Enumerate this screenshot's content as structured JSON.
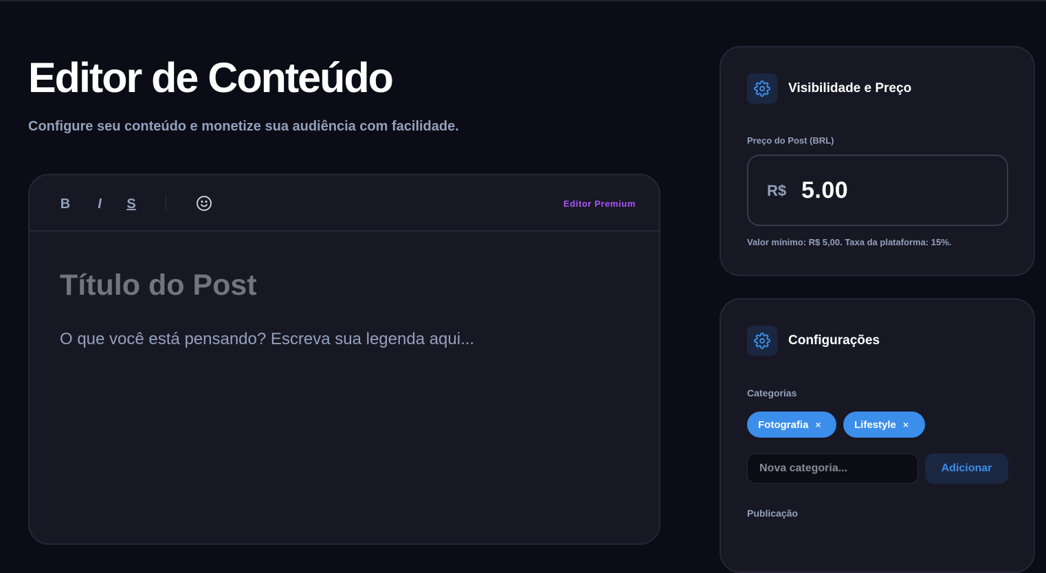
{
  "header": {
    "title": "Editor de Conteúdo",
    "subtitle": "Configure seu conteúdo e monetize sua audiência com facilidade."
  },
  "editor": {
    "toolbar": {
      "bold": "B",
      "italic": "I",
      "strike": "S",
      "emoji_icon": "smiley-icon",
      "badge": "Editor Premium"
    },
    "title_placeholder": "Título do Post",
    "caption_placeholder": "O que você está pensando? Escreva sua legenda aqui..."
  },
  "price_card": {
    "icon": "gear-icon",
    "title": "Visibilidade e Preço",
    "label": "Preço do Post (BRL)",
    "currency": "R$",
    "value": "5.00",
    "hint": "Valor mínimo: R$ 5,00. Taxa da plataforma: 15%."
  },
  "config_card": {
    "icon": "gear-icon",
    "title": "Configurações",
    "categories_label": "Categorias",
    "tags": [
      {
        "label": "Fotografia",
        "remove": "×"
      },
      {
        "label": "Lifestyle",
        "remove": "×"
      }
    ],
    "new_category_placeholder": "Nova categoria...",
    "add_button": "Adicionar",
    "publication_label": "Publicação"
  },
  "colors": {
    "background": "#0c0c16",
    "card": "#181824",
    "accent_blue": "#3b8eea",
    "accent_purple": "#a855f7",
    "muted": "#93a1bc"
  }
}
